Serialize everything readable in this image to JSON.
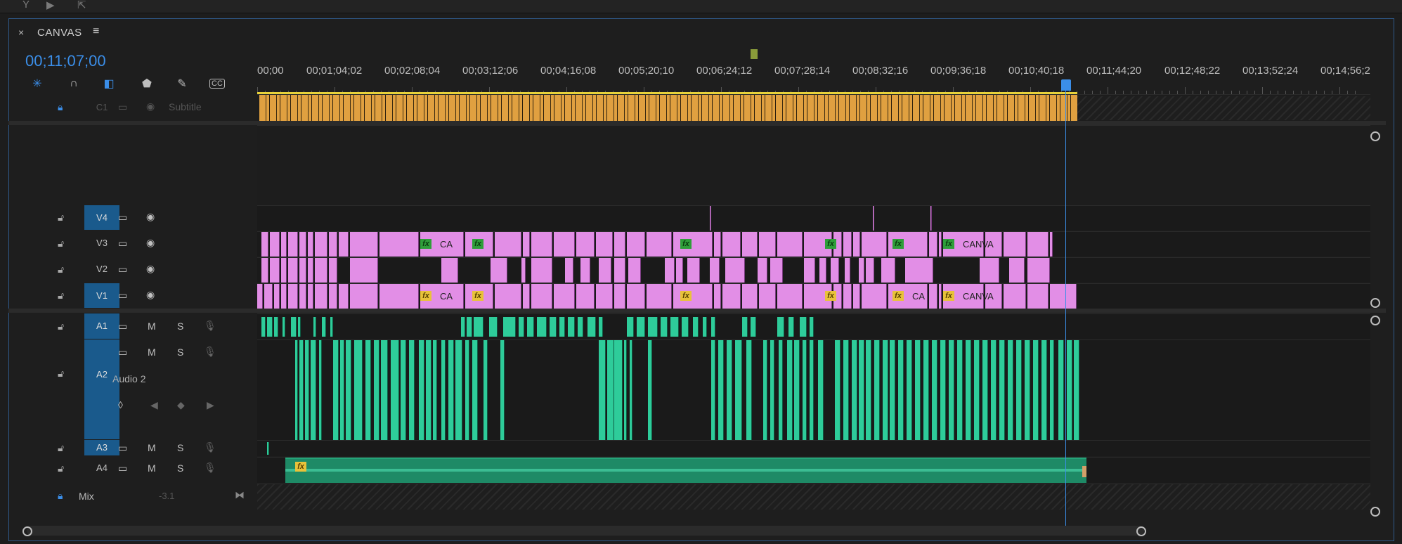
{
  "panel": {
    "title": "CANVAS",
    "close": "×",
    "menu": "≡"
  },
  "timecode": "00;11;07;00",
  "ruler": [
    "00;00",
    "00;01;04;02",
    "00;02;08;04",
    "00;03;12;06",
    "00;04;16;08",
    "00;05;20;10",
    "00;06;24;12",
    "00;07;28;14",
    "00;08;32;16",
    "00;09;36;18",
    "00;10;40;18",
    "00;11;44;20",
    "00;12;48;22",
    "00;13;52;24",
    "00;14;56;2"
  ],
  "tracks": {
    "c1": {
      "label": "C1",
      "name": "Subtitle"
    },
    "v4": "V4",
    "v3": "V3",
    "v2": "V2",
    "v1": "V1",
    "a1": "A1",
    "a2": "A2",
    "a2_name": "Audio 2",
    "a3": "A3",
    "a4": "A4",
    "mix": {
      "label": "Mix",
      "value": "-3.1"
    },
    "m": "M",
    "s": "S"
  },
  "clips": {
    "ca": "CA",
    "canva": "CANVA",
    "fx": "fx"
  },
  "colors": {
    "accent": "#3b8ee8",
    "video_clip": "#e28ee6",
    "audio_clip": "#2ecc9a",
    "caption": "#e0a040"
  }
}
